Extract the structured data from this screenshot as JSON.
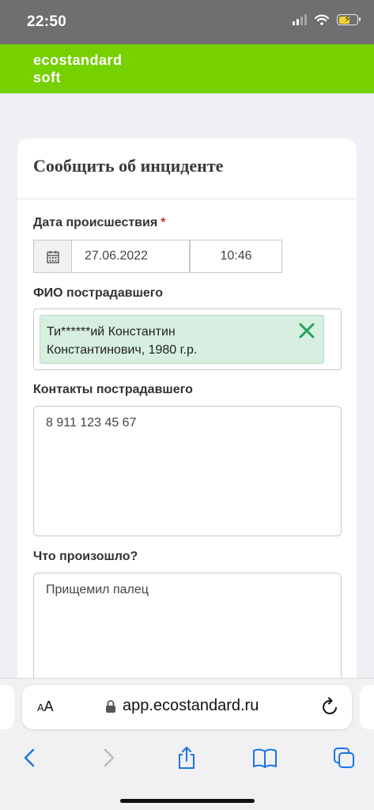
{
  "status_bar": {
    "time": "22:50"
  },
  "brand": {
    "line1": "ecostandard",
    "line2": "soft",
    "color": "#77d000"
  },
  "form": {
    "title": "Сообщить об инциденте",
    "date_label": "Дата происшествия",
    "required_mark": "*",
    "date_value": "27.06.2022",
    "time_value": "10:46",
    "fio_label": "ФИО пострадавшего",
    "fio_line1": "Ти******ий Константин",
    "fio_line2": "Константинович, 1980 г.р.",
    "contacts_label": "Контакты пострадавшего",
    "contacts_value": "8 911 123 45 67",
    "what_label": "Что произошло?",
    "what_value": "Прищемил палец"
  },
  "browser": {
    "aa_label_small": "A",
    "aa_label_large": "A",
    "url": "app.ecostandard.ru",
    "icons": [
      "lock-icon",
      "reload-icon",
      "back-icon",
      "forward-icon",
      "share-icon",
      "bookmarks-icon",
      "tabs-icon"
    ],
    "accent": "#1a73e8"
  }
}
